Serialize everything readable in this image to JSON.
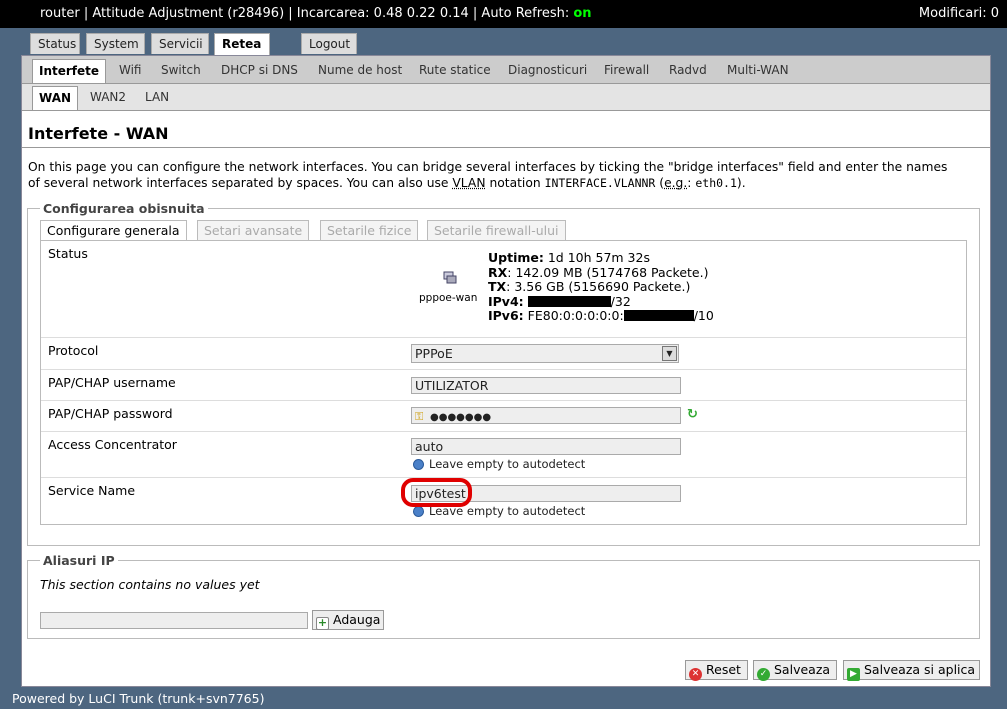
{
  "topbar": {
    "prefix": "router | Attitude Adjustment (r28496) | Incarcarea: 0.48 0.22 0.14 | Auto Refresh: ",
    "refresh_state": "on",
    "changes": "Modificari: 0"
  },
  "main_tabs": [
    "Status",
    "System",
    "Servicii",
    "Retea",
    "Logout"
  ],
  "sub_tabs": [
    "Interfete",
    "Wifi",
    "Switch",
    "DHCP si DNS",
    "Nume de host",
    "Rute statice",
    "Diagnosticuri",
    "Firewall",
    "Radvd",
    "Multi-WAN"
  ],
  "iface_tabs": [
    "WAN",
    "WAN2",
    "LAN"
  ],
  "page": {
    "title": "Interfete - WAN",
    "desc_1": "On this page you can configure the network interfaces. You can bridge several interfaces by ticking the \"bridge interfaces\" field and enter the names",
    "desc_2a": "of several network interfaces separated by spaces. You can also use ",
    "desc_vlan": "VLAN",
    "desc_2b": " notation ",
    "desc_code1": "INTERFACE.VLANNR",
    "desc_2c": " (",
    "desc_eg": "e.g.",
    "desc_2d": ": ",
    "desc_code2": "eth0.1",
    "desc_2e": ")."
  },
  "general": {
    "legend": "Configurarea obisnuita",
    "tabs": [
      "Configurare generala",
      "Setari avansate",
      "Setarile fizice",
      "Setarile firewall-ului"
    ]
  },
  "status": {
    "label": "Status",
    "iface_name": "pppoe-wan",
    "uptime_label": "Uptime:",
    "uptime": "1d 10h 57m 32s",
    "rx_label": "RX",
    "rx": ": 142.09 MB (5174768 Packete.)",
    "tx_label": "TX",
    "tx": ": 3.56 GB (5156690 Packete.)",
    "ipv4_label": "IPv4:",
    "ipv4_suffix": "/32",
    "ipv6_label": "IPv6:",
    "ipv6_prefix": "FE80:0:0:0:0:0:",
    "ipv6_suffix": "/10"
  },
  "fields": {
    "protocol_label": "Protocol",
    "protocol_value": "PPPoE",
    "username_label": "PAP/CHAP username",
    "username_value": "UTILIZATOR",
    "password_label": "PAP/CHAP password",
    "password_value": "●●●●●●●",
    "ac_label": "Access Concentrator",
    "ac_value": "auto",
    "ac_hint": "Leave empty to autodetect",
    "service_label": "Service Name",
    "service_value": "ipv6test",
    "service_hint": "Leave empty to autodetect"
  },
  "alias": {
    "legend": "Aliasuri IP",
    "empty": "This section contains no values yet",
    "add_label": "Adauga"
  },
  "actions": {
    "reset": "Reset",
    "save": "Salveaza",
    "save_apply": "Salveaza si aplica"
  },
  "footer": "Powered by LuCI Trunk (trunk+svn7765)",
  "colors": {
    "background": "#4d6680",
    "refresh_on": "#00ff00",
    "highlight": "#e00000"
  }
}
